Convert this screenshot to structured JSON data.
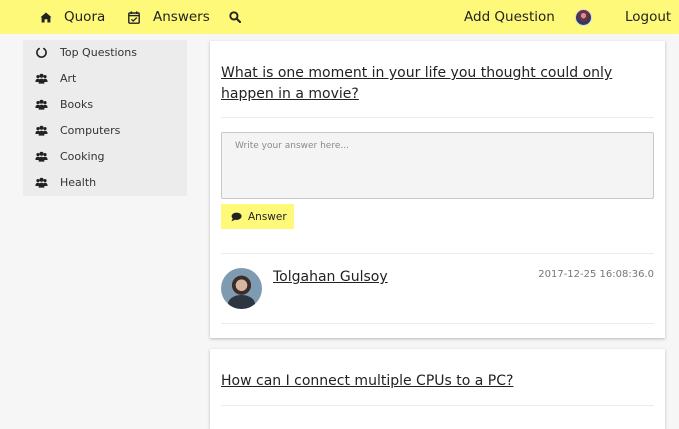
{
  "nav": {
    "brand_label": "Quora",
    "answers_label": "Answers",
    "add_question_label": "Add Question",
    "logout_label": "Logout",
    "icons": [
      "home-icon",
      "calendar-check-icon",
      "search-icon"
    ]
  },
  "sidebar": {
    "items": [
      {
        "label": "Top Questions",
        "icon": "circle-notch-icon"
      },
      {
        "label": "Art",
        "icon": "users-icon"
      },
      {
        "label": "Books",
        "icon": "users-icon"
      },
      {
        "label": "Computers",
        "icon": "users-icon"
      },
      {
        "label": "Cooking",
        "icon": "users-icon"
      },
      {
        "label": "Health",
        "icon": "users-icon"
      }
    ]
  },
  "questions": [
    {
      "title": "What is one moment in your life you thought could only happen in a movie?",
      "answer_placeholder": "Write your answer here...",
      "answer_button_label": "Answer",
      "answer": {
        "author": "Tolgahan Gulsoy",
        "timestamp": "2017-12-25 16:08:36.0"
      }
    },
    {
      "title": "How can I connect multiple CPUs to a PC?"
    }
  ],
  "colors": {
    "accent": "#fff97a",
    "page_bg": "#f6f6f7",
    "sidebar_bg": "#ececec"
  }
}
